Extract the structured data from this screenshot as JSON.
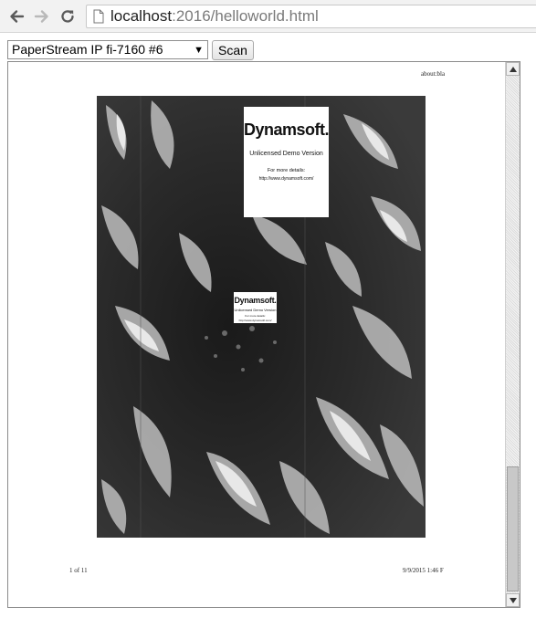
{
  "browser": {
    "url_host": "localhost",
    "url_path": ":2016/helloworld.html",
    "back_icon": "back-arrow-icon",
    "forward_icon": "forward-arrow-icon",
    "reload_icon": "reload-icon",
    "page_icon": "page-icon"
  },
  "controls": {
    "source_selected": "PaperStream IP fi-7160 #6",
    "scan_label": "Scan"
  },
  "document": {
    "header_right": "about:bla",
    "footer_left": "1 of 11",
    "footer_right": "9/9/2015 1:46 F"
  },
  "watermark": {
    "logo": "Dynamsoft.",
    "title": "Unlicensed Demo Version",
    "details": "For more details:",
    "url": "http://www.dynamsoft.com/"
  },
  "colors": {
    "toolbar_bg": "#f2f2f2",
    "scan_bg": "#0a0a0a",
    "scrollbar_thumb": "#c8c8c8"
  }
}
